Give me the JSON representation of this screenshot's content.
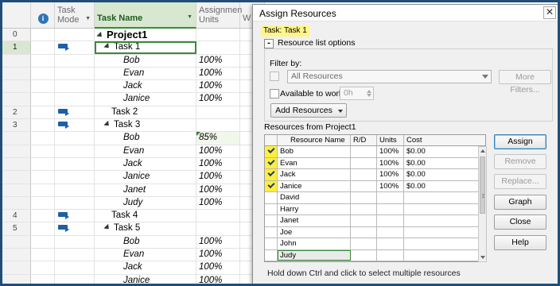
{
  "grid": {
    "headers": {
      "task_mode": "Task Mode",
      "task_name": "Task Name",
      "assignment_units": "Assignmen Units",
      "extra": "W"
    },
    "rows": [
      {
        "id": "0",
        "mode": false,
        "name": "Project1",
        "units": "",
        "level": "project"
      },
      {
        "id": "1",
        "mode": true,
        "name": "Task 1",
        "units": "",
        "level": "summary",
        "active": true
      },
      {
        "id": "",
        "mode": false,
        "name": "Bob",
        "units": "100%",
        "level": "assign"
      },
      {
        "id": "",
        "mode": false,
        "name": "Evan",
        "units": "100%",
        "level": "assign"
      },
      {
        "id": "",
        "mode": false,
        "name": "Jack",
        "units": "100%",
        "level": "assign"
      },
      {
        "id": "",
        "mode": false,
        "name": "Janice",
        "units": "100%",
        "level": "assign"
      },
      {
        "id": "2",
        "mode": true,
        "name": "Task 2",
        "units": "",
        "level": "task"
      },
      {
        "id": "3",
        "mode": true,
        "name": "Task 3",
        "units": "",
        "level": "summary"
      },
      {
        "id": "",
        "mode": false,
        "name": "Bob",
        "units": "85%",
        "level": "assign",
        "hl": true
      },
      {
        "id": "",
        "mode": false,
        "name": "Evan",
        "units": "100%",
        "level": "assign"
      },
      {
        "id": "",
        "mode": false,
        "name": "Jack",
        "units": "100%",
        "level": "assign"
      },
      {
        "id": "",
        "mode": false,
        "name": "Janice",
        "units": "100%",
        "level": "assign"
      },
      {
        "id": "",
        "mode": false,
        "name": "Janet",
        "units": "100%",
        "level": "assign"
      },
      {
        "id": "",
        "mode": false,
        "name": "Judy",
        "units": "100%",
        "level": "assign"
      },
      {
        "id": "4",
        "mode": true,
        "name": "Task 4",
        "units": "",
        "level": "task"
      },
      {
        "id": "5",
        "mode": true,
        "name": "Task 5",
        "units": "",
        "level": "summary"
      },
      {
        "id": "",
        "mode": false,
        "name": "Bob",
        "units": "100%",
        "level": "assign"
      },
      {
        "id": "",
        "mode": false,
        "name": "Evan",
        "units": "100%",
        "level": "assign"
      },
      {
        "id": "",
        "mode": false,
        "name": "Jack",
        "units": "100%",
        "level": "assign"
      },
      {
        "id": "",
        "mode": false,
        "name": "Janice",
        "units": "100%",
        "level": "assign"
      }
    ]
  },
  "dialog": {
    "title": "Assign Resources",
    "close": "✕",
    "task_label": "Task: Task 1",
    "collapse_symbol": "-",
    "resource_list_options": "Resource list options",
    "filter_by": "Filter by:",
    "filter_value": "All Resources",
    "more_filters": "More Filters...",
    "available_to_work": "Available to work",
    "available_value": "0h",
    "add_resources": "Add Resources",
    "resources_from": "Resources from Project1",
    "table_headers": {
      "name": "Resource Name",
      "rd": "R/D",
      "units": "Units",
      "cost": "Cost"
    },
    "resources": [
      {
        "name": "Bob",
        "units": "100%",
        "cost": "$0.00",
        "assigned": true
      },
      {
        "name": "Evan",
        "units": "100%",
        "cost": "$0.00",
        "assigned": true
      },
      {
        "name": "Jack",
        "units": "100%",
        "cost": "$0.00",
        "assigned": true
      },
      {
        "name": "Janice",
        "units": "100%",
        "cost": "$0.00",
        "assigned": true
      },
      {
        "name": "David",
        "units": "",
        "cost": "",
        "assigned": false
      },
      {
        "name": "Harry",
        "units": "",
        "cost": "",
        "assigned": false
      },
      {
        "name": "Janet",
        "units": "",
        "cost": "",
        "assigned": false
      },
      {
        "name": "Joe",
        "units": "",
        "cost": "",
        "assigned": false
      },
      {
        "name": "John",
        "units": "",
        "cost": "",
        "assigned": false
      },
      {
        "name": "Judy",
        "units": "",
        "cost": "",
        "assigned": false,
        "selected": true
      }
    ],
    "buttons": {
      "assign": "Assign",
      "remove": "Remove",
      "replace": "Replace...",
      "graph": "Graph",
      "close": "Close",
      "help": "Help"
    },
    "hint": "Hold down Ctrl and click to select multiple resources"
  }
}
